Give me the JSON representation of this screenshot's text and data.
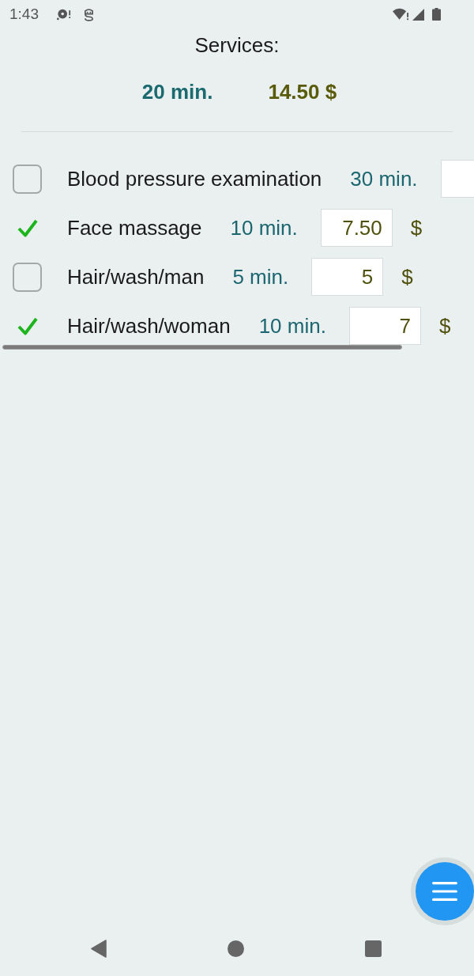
{
  "status_bar": {
    "time": "1:43"
  },
  "header": {
    "title": "Services:",
    "total_time": "20 min.",
    "total_price": "14.50 $"
  },
  "services": [
    {
      "name": "Blood pressure examination",
      "checked": false,
      "duration": "30 min."
    },
    {
      "name": "Face massage",
      "checked": true,
      "duration": "10 min.",
      "price": "7.50",
      "currency": "$"
    },
    {
      "name": "Hair/wash/man",
      "checked": false,
      "duration": "5 min.",
      "price": "5",
      "currency": "$"
    },
    {
      "name": "Hair/wash/woman",
      "checked": true,
      "duration": "10 min.",
      "price": "7",
      "currency": "$"
    }
  ]
}
